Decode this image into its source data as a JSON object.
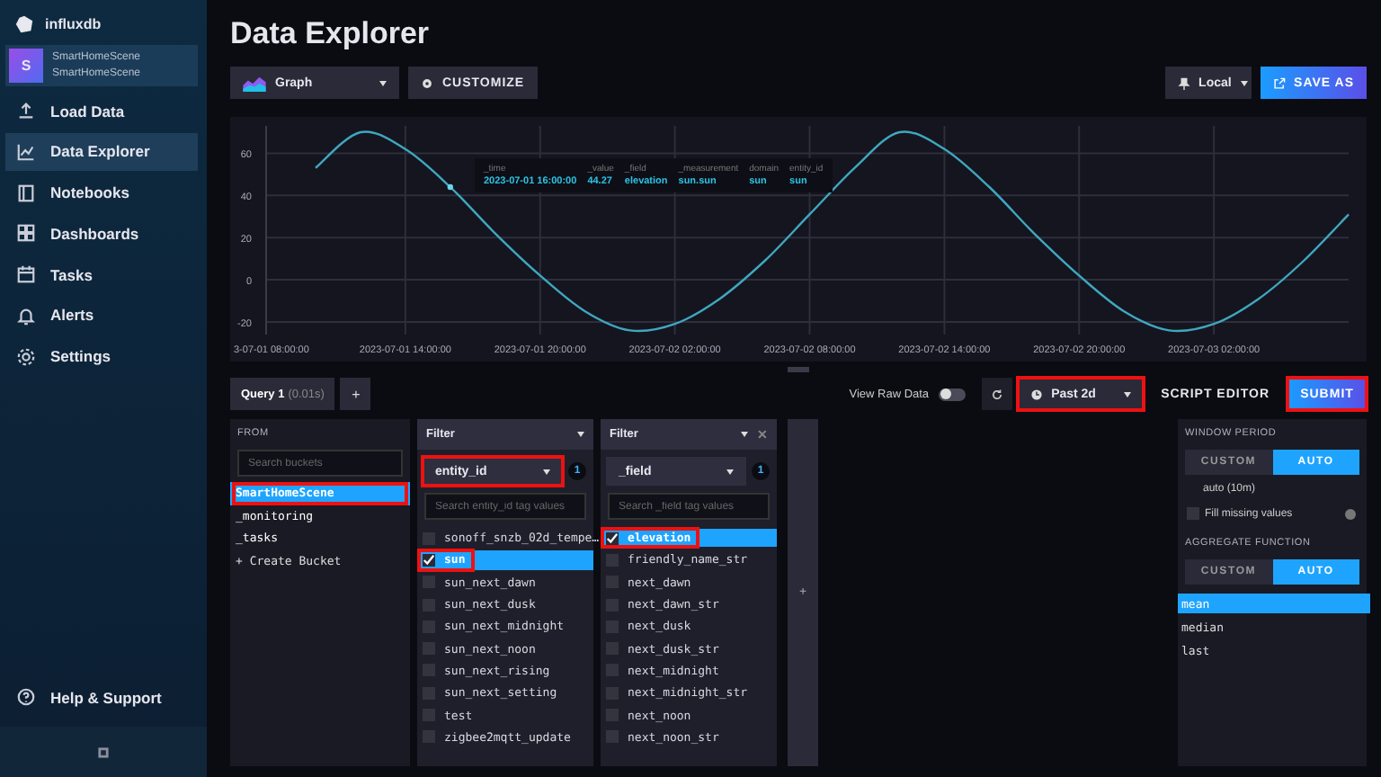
{
  "app": {
    "logo": "influxdb"
  },
  "org": {
    "initial": "S",
    "name": "SmartHomeScene",
    "subtitle": "SmartHomeScene"
  },
  "nav": [
    {
      "label": "Load Data",
      "selected": false
    },
    {
      "label": "Data Explorer",
      "selected": true
    },
    {
      "label": "Notebooks",
      "selected": false
    },
    {
      "label": "Dashboards",
      "selected": false
    },
    {
      "label": "Tasks",
      "selected": false
    },
    {
      "label": "Alerts",
      "selected": false
    },
    {
      "label": "Settings",
      "selected": false
    }
  ],
  "help": "Help & Support",
  "page_title": "Data Explorer",
  "toolbar": {
    "view_type": "Graph",
    "customize": "CUSTOMIZE",
    "timezone": "Local",
    "save_as": "SAVE AS"
  },
  "graph": {
    "chart_data": {
      "type": "line",
      "categories": [
        "3-07-01 08:00:00",
        null,
        null,
        "2023-07-01 14:00:00",
        null,
        null,
        "2023-07-01 20:00:00",
        null,
        null,
        "2023-07-02 02:00:00",
        null,
        null,
        "2023-07-02 08:00:00",
        null,
        null,
        "2023-07-02 14:00:00",
        null,
        null,
        "2023-07-02 20:00:00",
        null,
        null,
        "2023-07-03 02:00:00",
        null,
        null,
        null
      ],
      "series": [
        {
          "color": "#3fa7bf",
          "values": [
            null,
            53,
            70,
            62,
            44,
            22,
            2,
            -15,
            -24,
            -21,
            -9,
            9,
            31,
            53,
            70,
            62,
            44,
            22,
            2,
            -15,
            -24,
            -21,
            -9,
            9,
            31
          ]
        }
      ],
      "ylim": [
        -26,
        73
      ],
      "grid": true,
      "yticks": [
        -20,
        0,
        20,
        40,
        60
      ]
    },
    "tooltip": [
      {
        "header": "_time",
        "value": "2023-07-01 16:00:00"
      },
      {
        "header": "_value",
        "value": "44.27"
      },
      {
        "header": "_field",
        "value": "elevation"
      },
      {
        "header": "_measurement",
        "value": "sun.sun"
      },
      {
        "header": "domain",
        "value": "sun"
      },
      {
        "header": "entity_id",
        "value": "sun"
      }
    ]
  },
  "query_bar": {
    "tabs": [
      {
        "label": "Query 1",
        "detail": "(0.01s)",
        "selected": true
      }
    ],
    "add": "+",
    "raw_data": {
      "label": "View Raw Data",
      "on": false
    },
    "time_range": {
      "label": "Past 2d",
      "highlighted": true
    },
    "script_editor": "SCRIPT EDITOR",
    "submit": {
      "label": "SUBMIT",
      "highlighted": true
    }
  },
  "from": {
    "title": "FROM",
    "placeholder": "Search buckets",
    "buckets": [
      {
        "kind": "bucket",
        "name": "SmartHomeScene",
        "selected": true,
        "highlighted": true
      },
      {
        "kind": "bucket",
        "name": "_monitoring",
        "selected": false,
        "highlighted": false
      },
      {
        "kind": "bucket",
        "name": "_tasks",
        "selected": false,
        "highlighted": false
      },
      {
        "kind": "action",
        "name": "+ Create Bucket"
      }
    ]
  },
  "filters": [
    {
      "title": "Filter",
      "key": "entity_id",
      "key_highlighted": true,
      "count": "1",
      "placeholder": "Search entity_id tag values",
      "values": [
        {
          "label": "sonoff_snzb_02d_tempe…",
          "checked": false,
          "highlighted": false
        },
        {
          "label": "sun",
          "checked": true,
          "highlighted": true
        },
        {
          "label": "sun_next_dawn",
          "checked": false,
          "highlighted": false
        },
        {
          "label": "sun_next_dusk",
          "checked": false,
          "highlighted": false
        },
        {
          "label": "sun_next_midnight",
          "checked": false,
          "highlighted": false
        },
        {
          "label": "sun_next_noon",
          "checked": false,
          "highlighted": false
        },
        {
          "label": "sun_next_rising",
          "checked": false,
          "highlighted": false
        },
        {
          "label": "sun_next_setting",
          "checked": false,
          "highlighted": false
        },
        {
          "label": "test",
          "checked": false,
          "highlighted": false
        },
        {
          "label": "zigbee2mqtt_update",
          "checked": false,
          "highlighted": false
        }
      ]
    },
    {
      "title": "Filter",
      "key": "_field",
      "key_highlighted": false,
      "count": "1",
      "close": "✕",
      "placeholder": "Search _field tag values",
      "values": [
        {
          "label": "elevation",
          "checked": true,
          "highlighted": true
        },
        {
          "label": "friendly_name_str",
          "checked": false,
          "highlighted": false
        },
        {
          "label": "next_dawn",
          "checked": false,
          "highlighted": false
        },
        {
          "label": "next_dawn_str",
          "checked": false,
          "highlighted": false
        },
        {
          "label": "next_dusk",
          "checked": false,
          "highlighted": false
        },
        {
          "label": "next_dusk_str",
          "checked": false,
          "highlighted": false
        },
        {
          "label": "next_midnight",
          "checked": false,
          "highlighted": false
        },
        {
          "label": "next_midnight_str",
          "checked": false,
          "highlighted": false
        },
        {
          "label": "next_noon",
          "checked": false,
          "highlighted": false
        },
        {
          "label": "next_noon_str",
          "checked": false,
          "highlighted": false
        }
      ]
    }
  ],
  "add_filter": "+",
  "window_period": {
    "title": "WINDOW PERIOD",
    "modes": [
      {
        "label": "CUSTOM",
        "selected": false
      },
      {
        "label": "AUTO",
        "selected": true
      }
    ],
    "value": "auto (10m)",
    "fill_missing": {
      "label": "Fill missing values",
      "checked": false
    }
  },
  "aggregate": {
    "title": "AGGREGATE FUNCTION",
    "modes": [
      {
        "label": "CUSTOM",
        "selected": false
      },
      {
        "label": "AUTO",
        "selected": true
      }
    ],
    "functions": [
      {
        "label": "mean",
        "selected": true
      },
      {
        "label": "median",
        "selected": false
      },
      {
        "label": "last",
        "selected": false
      }
    ]
  }
}
